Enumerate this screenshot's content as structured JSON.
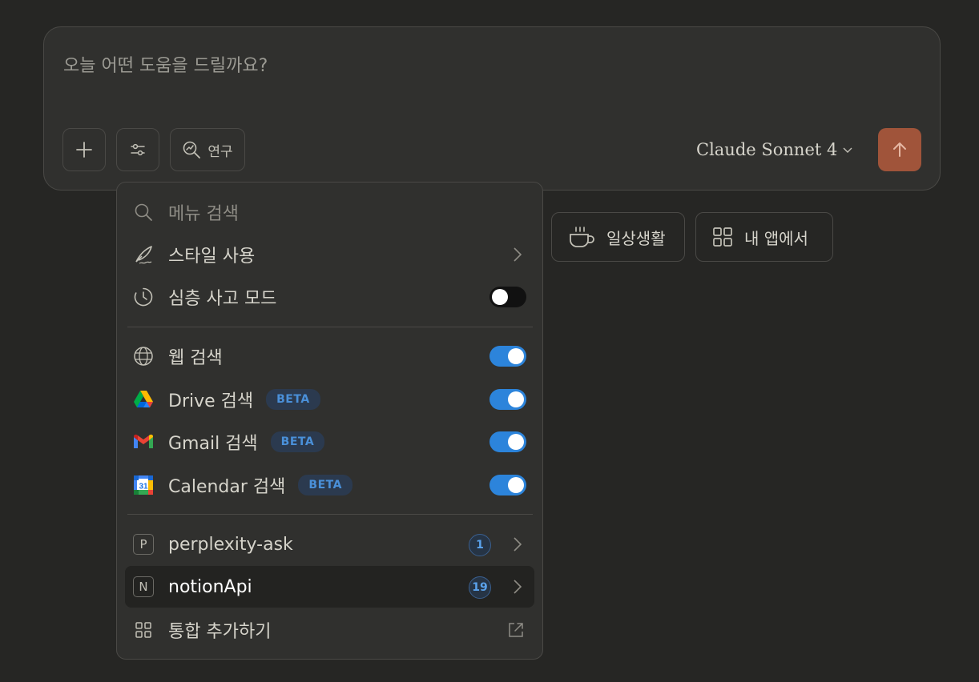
{
  "composer": {
    "placeholder": "오늘 어떤 도움을 드릴까요?",
    "research_label": "연구",
    "model_name": "Claude Sonnet 4"
  },
  "chips": {
    "daily_label": "일상생활",
    "apps_label": "내 앱에서"
  },
  "menu": {
    "search_placeholder": "메뉴 검색",
    "style_label": "스타일 사용",
    "deep_think_label": "심층 사고 모드",
    "deep_think_on": false,
    "web_search_label": "웹 검색",
    "web_search_on": true,
    "drive_label": "Drive 검색",
    "drive_on": true,
    "gmail_label": "Gmail 검색",
    "gmail_on": true,
    "calendar_label": "Calendar 검색",
    "calendar_on": true,
    "beta_badge": "BETA",
    "calendar_icon_day": "31",
    "integrations": [
      {
        "letter": "P",
        "name": "perplexity-ask",
        "count": "1"
      },
      {
        "letter": "N",
        "name": "notionApi",
        "count": "19"
      }
    ],
    "add_integration_label": "통합 추가하기"
  },
  "colors": {
    "accent_send": "#a0543a",
    "toggle_on": "#2c84db",
    "beta_text": "#4a90d9"
  }
}
